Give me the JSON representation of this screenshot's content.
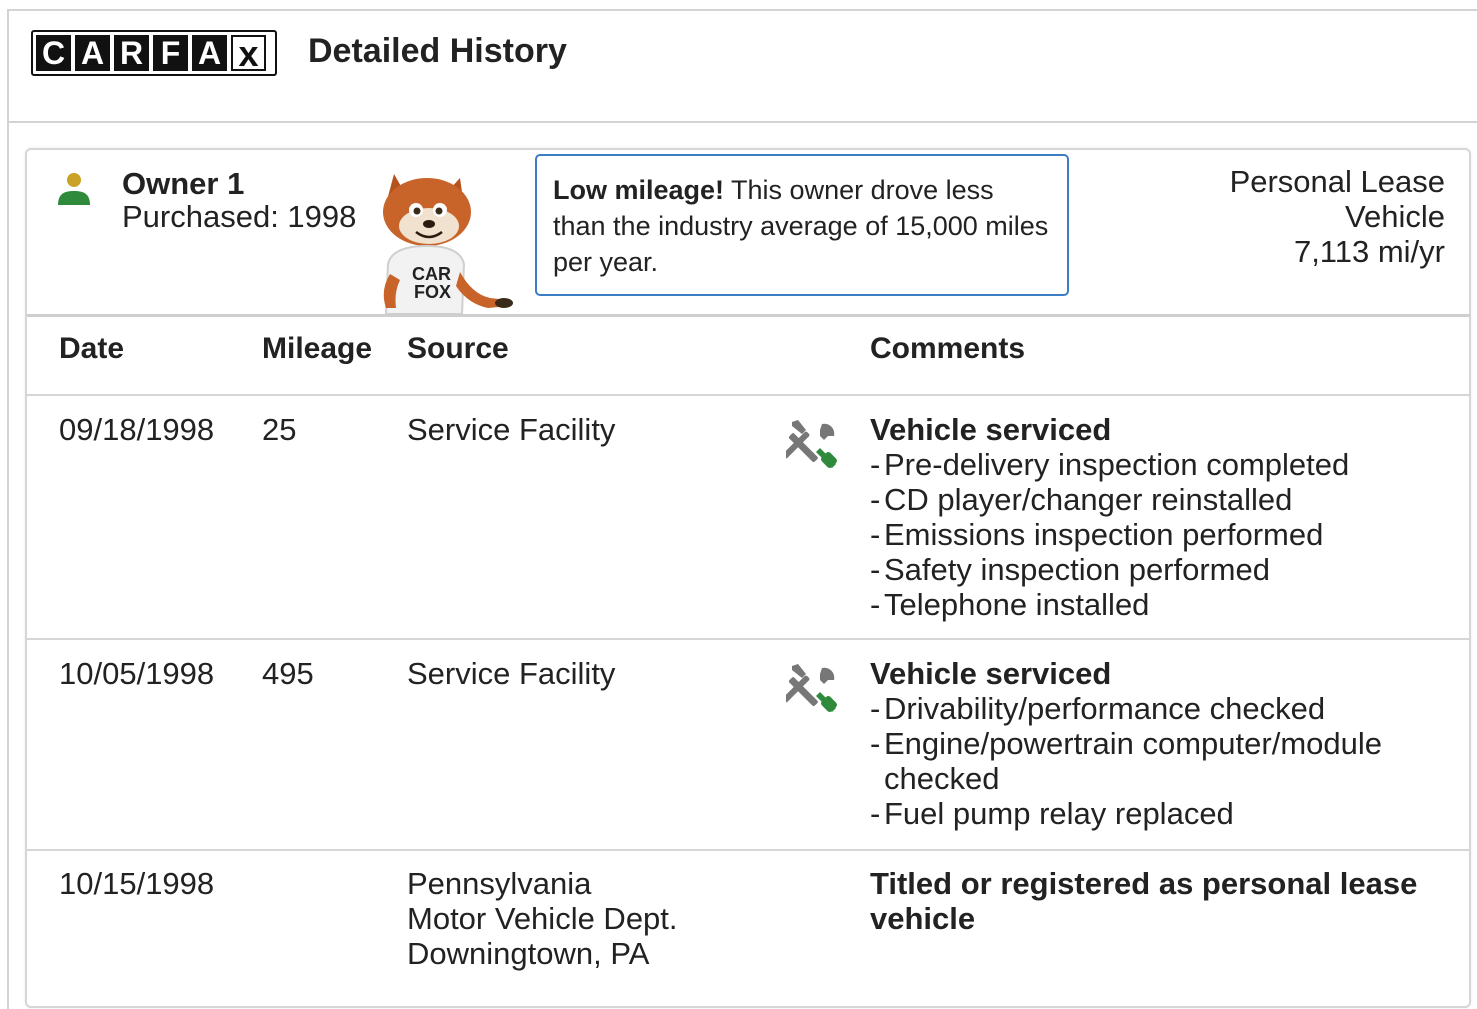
{
  "header": {
    "logo_letters": [
      "C",
      "A",
      "R",
      "F",
      "A",
      "x"
    ],
    "title": "Detailed History"
  },
  "owner": {
    "name": "Owner 1",
    "purchased": "Purchased: 1998",
    "callout_bold": "Low mileage!",
    "callout_text": " This owner drove less than the industry average of 15,000 miles per year.",
    "usage_type": "Personal Lease Vehicle",
    "mileage_rate": "7,113 mi/yr",
    "fox_shirt_text": "CAR FOX"
  },
  "table": {
    "columns": {
      "date": "Date",
      "mileage": "Mileage",
      "source": "Source",
      "comments": "Comments"
    },
    "rows": [
      {
        "date": "09/18/1998",
        "mileage": "25",
        "source": "Service Facility",
        "icon": "wrench-screwdriver-icon",
        "comment_title": "Vehicle serviced",
        "comment_items": [
          "Pre-delivery inspection completed",
          "CD player/changer reinstalled",
          "Emissions inspection performed",
          "Safety inspection performed",
          "Telephone installed"
        ]
      },
      {
        "date": "10/05/1998",
        "mileage": "495",
        "source": "Service Facility",
        "icon": "wrench-screwdriver-icon",
        "comment_title": "Vehicle serviced",
        "comment_items": [
          "Drivability/performance checked",
          "Engine/powertrain computer/module checked",
          "Fuel pump relay replaced"
        ]
      },
      {
        "date": "10/15/1998",
        "mileage": "",
        "source_lines": [
          "Pennsylvania",
          "Motor Vehicle Dept.",
          "Downingtown, PA"
        ],
        "comment_title": "Titled or registered as personal lease vehicle"
      }
    ]
  },
  "colors": {
    "owner_head": "#c9a227",
    "owner_body": "#2f8a3c",
    "callout_border": "#3b7dc4",
    "tool_gray": "#777777",
    "tool_green": "#2f8a3c"
  }
}
